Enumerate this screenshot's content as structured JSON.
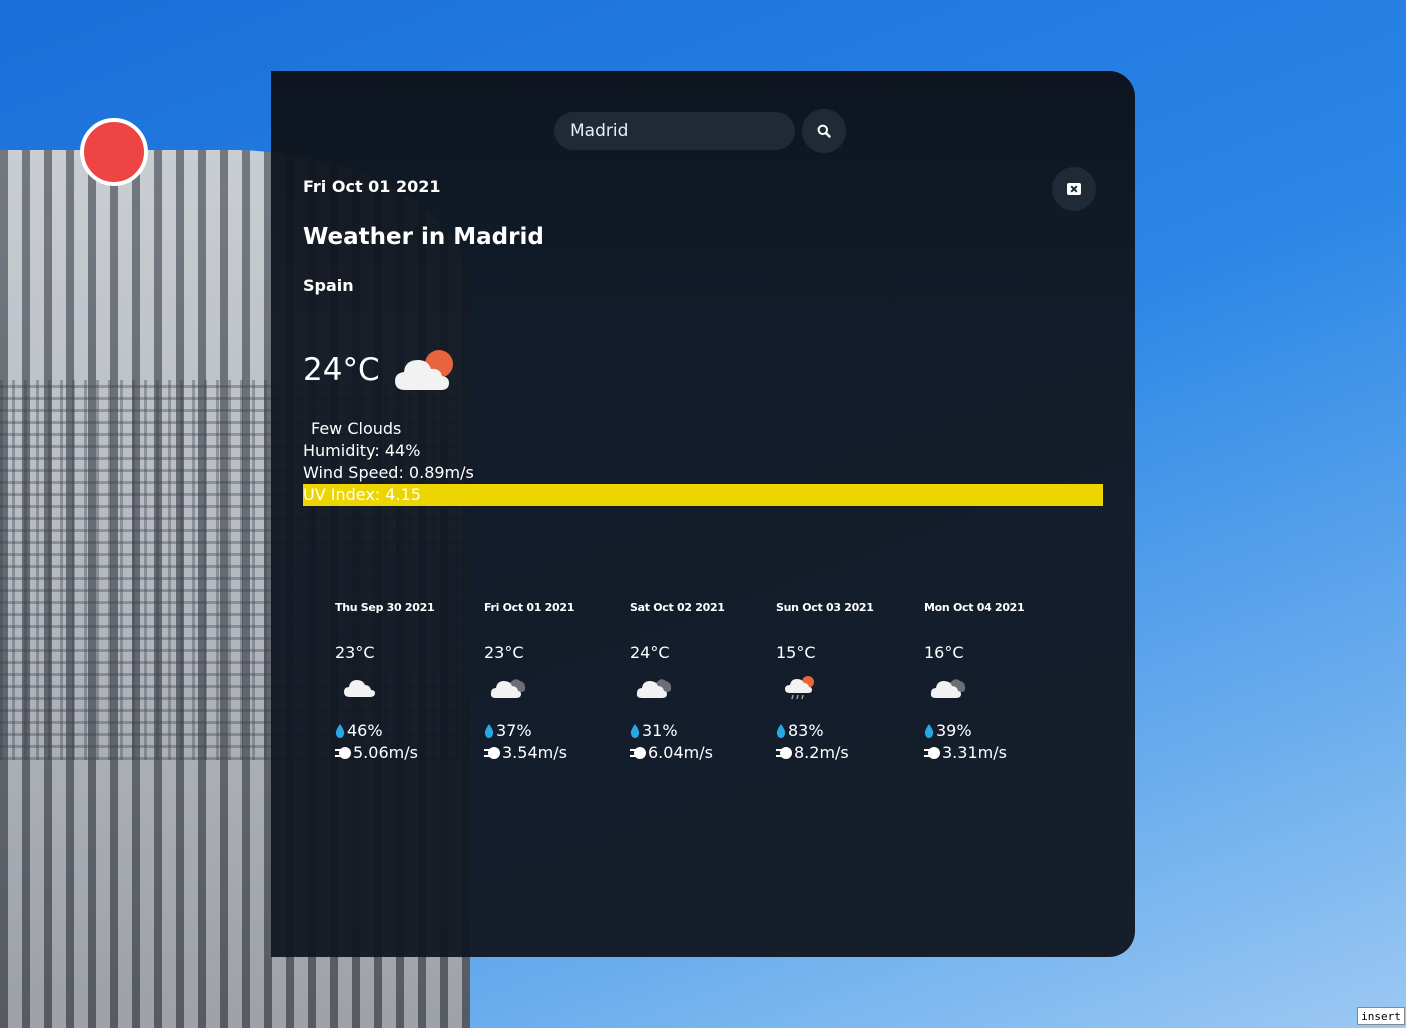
{
  "search": {
    "value": "Madrid",
    "placeholder": ""
  },
  "current": {
    "date": "Fri Oct 01 2021",
    "title": "Weather in Madrid",
    "country": "Spain",
    "temperature": "24°C",
    "icon": "few-clouds-day-icon",
    "description": "Few Clouds",
    "humidity": "Humidity: 44%",
    "wind": "Wind Speed: 0.89m/s",
    "uv": "UV Index: 4.15",
    "uv_color": "#ecd500"
  },
  "forecast": [
    {
      "date": "Thu Sep 30 2021",
      "temp": "23°C",
      "icon": "cloud-icon",
      "humidity": "46%",
      "wind": "5.06m/s"
    },
    {
      "date": "Fri Oct 01 2021",
      "temp": "23°C",
      "icon": "broken-clouds-icon",
      "humidity": "37%",
      "wind": "3.54m/s"
    },
    {
      "date": "Sat Oct 02 2021",
      "temp": "24°C",
      "icon": "broken-clouds-icon",
      "humidity": "31%",
      "wind": "6.04m/s"
    },
    {
      "date": "Sun Oct 03 2021",
      "temp": "15°C",
      "icon": "rain-sun-icon",
      "humidity": "83%",
      "wind": "8.2m/s"
    },
    {
      "date": "Mon Oct 04 2021",
      "temp": "16°C",
      "icon": "broken-clouds-icon",
      "humidity": "39%",
      "wind": "3.31m/s"
    }
  ],
  "status": {
    "insert_mode": "insert"
  },
  "colors": {
    "card_bg": "#121822",
    "accent_sun": "#e8643c",
    "uv_moderate": "#ecd500",
    "drop": "#29a8e6"
  }
}
